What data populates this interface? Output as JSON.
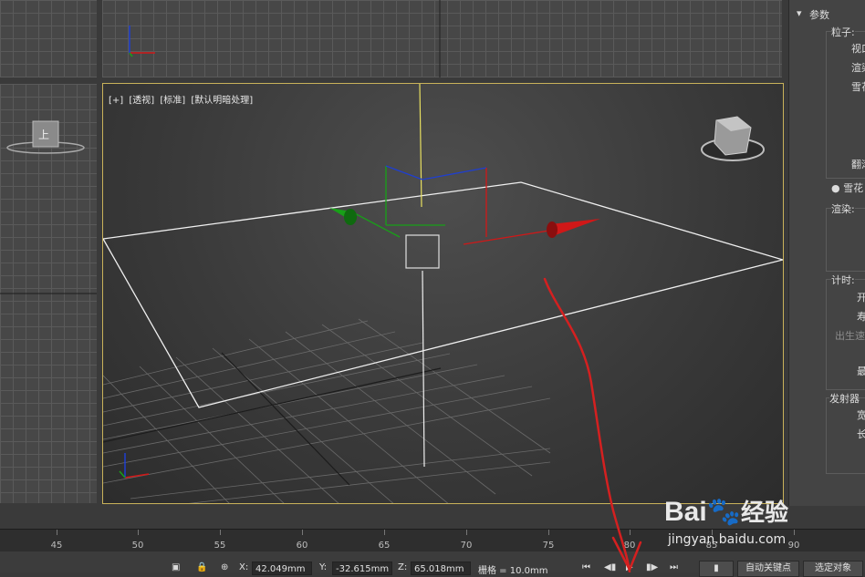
{
  "viewport": {
    "label_parts": [
      "[+]",
      "[透视]",
      "[标准]",
      "[默认明暗处理]"
    ],
    "top_view_label": "上"
  },
  "command_panel": {
    "section_title": "参数",
    "particles_label": "粒子:",
    "viewport_count_label": "视口",
    "render_count_label": "渲染",
    "drop_size_label": "雪花",
    "tumble_label": "翻滚",
    "snowflake_radio": "雪花",
    "render_label": "渲染:",
    "timing_label": "计时:",
    "start_label": "开",
    "life_label": "寿",
    "birth_rate_label": "出生速",
    "max_label": "最",
    "emitter_label": "发射器",
    "width_label": "宽",
    "length_label": "长"
  },
  "timeline": {
    "ticks": [
      "45",
      "50",
      "55",
      "60",
      "65",
      "70",
      "75",
      "80",
      "85",
      "90"
    ]
  },
  "status": {
    "x_label": "X:",
    "x_value": "42.049mm",
    "y_label": "Y:",
    "y_value": "-32.615mm",
    "z_label": "Z:",
    "z_value": "65.018mm",
    "grid_label": "栅格 = 10.0mm",
    "auto_key": "自动关键点",
    "selected_object": "选定对象"
  },
  "watermark": {
    "brand_a": "Bai",
    "brand_b": "经验",
    "url": "jingyan.baidu.com"
  },
  "colors": {
    "viewport_border": "#c9b25a",
    "axis_x": "#d01818",
    "axis_y": "#18a018",
    "axis_z": "#1f3fd0",
    "annotation": "#d42020"
  }
}
